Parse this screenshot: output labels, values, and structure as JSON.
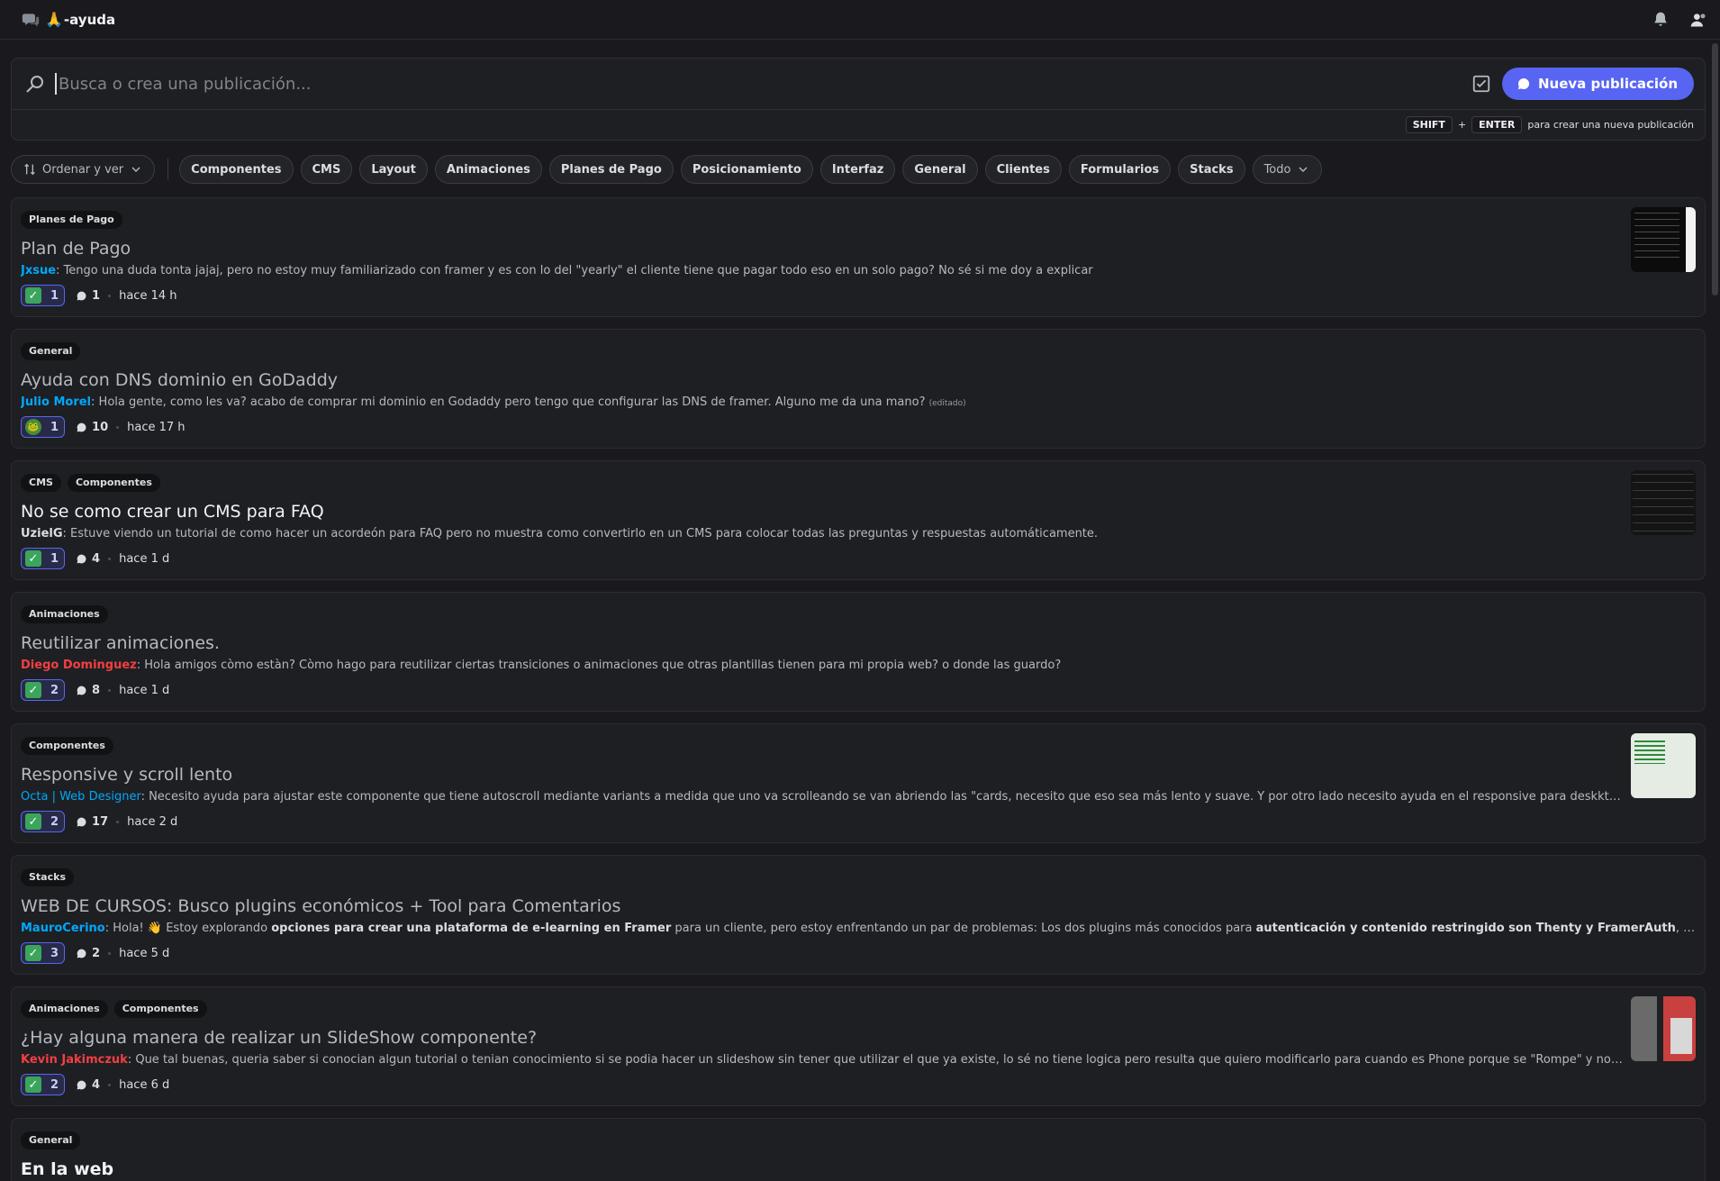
{
  "header": {
    "channel_emoji": "🙏",
    "channel_name": "-ayuda",
    "icons": [
      "forum-icon",
      "bell-icon",
      "members-icon"
    ]
  },
  "search": {
    "placeholder": "Busca o crea una publicación...",
    "new_post_label": "Nueva publicación",
    "hint_key1": "SHIFT",
    "hint_plus": "+",
    "hint_key2": "ENTER",
    "hint_text": "para crear una nueva publicación"
  },
  "filters": {
    "sort_label": "Ordenar y ver",
    "tags": [
      "Componentes",
      "CMS",
      "Layout",
      "Animaciones",
      "Planes de Pago",
      "Posicionamiento",
      "Interfaz",
      "General",
      "Clientes",
      "Formularios",
      "Stacks"
    ],
    "all_label": "Todo"
  },
  "colors": {
    "accent": "#5865f2",
    "author_blue": "#00a8fc",
    "author_red": "#f23f43",
    "background": "#1a1a1e",
    "card": "#1e1f22"
  },
  "posts": [
    {
      "tags": [
        "Planes de Pago"
      ],
      "title": "Plan de Pago",
      "author": "Jxsue",
      "author_sep": ":",
      "body": " Tengo una duda tonta jajaj, pero no estoy muy familiarizado con framer y es con lo del \"yearly\" el cliente tiene que pagar todo eso en un solo pago? No sé si me doy a explicar",
      "reaction": "✓",
      "reaction_count": "1",
      "comments": "1",
      "time": "hace 14 h"
    },
    {
      "tags": [
        "General"
      ],
      "title": "Ayuda con DNS dominio en GoDaddy",
      "author": "Julio Morel",
      "author_sep": ":",
      "body": " Hola gente, como les va? acabo de comprar mi dominio en Godaddy pero tengo que configurar las DNS de framer. Alguno me da una mano? ",
      "edited": "(editado)",
      "reaction": "🐸",
      "reaction_count": "1",
      "comments": "10",
      "time": "hace 17 h"
    },
    {
      "tags": [
        "CMS",
        "Componentes"
      ],
      "title": "No se como crear un CMS para FAQ",
      "author": "UzielG",
      "author_sep": ":",
      "body": " Estuve viendo un tutorial de como hacer un acordeón para FAQ pero no muestra como convertirlo en un CMS para colocar todas las preguntas y respuestas automáticamente.",
      "reaction": "✓",
      "reaction_count": "1",
      "comments": "4",
      "time": "hace 1 d"
    },
    {
      "tags": [
        "Animaciones"
      ],
      "title": "Reutilizar animaciones.",
      "author": "Diego Dominguez",
      "author_sep": ":",
      "body": " Hola amigos còmo estàn? Còmo hago para reutilizar ciertas transiciones o animaciones que otras plantillas tienen para mi propia web? o donde las guardo?",
      "reaction": "✓",
      "reaction_count": "2",
      "comments": "8",
      "time": "hace 1 d"
    },
    {
      "tags": [
        "Componentes"
      ],
      "title": "Responsive y scroll lento",
      "author": "Octa | Web Designer",
      "author_sep": ":",
      "body": " Necesito ayuda para ajustar este componente que tiene autoscroll mediante variants a medida que uno va scrolleando se van abriendo las \"cards, necesito que eso sea más lento y suave. Y por otro lado necesito ayuda en el responsive para deskktop y mobile. En pc no se ab...",
      "reaction": "✓",
      "reaction_count": "2",
      "comments": "17",
      "time": "hace 2 d"
    },
    {
      "tags": [
        "Stacks"
      ],
      "title": "WEB DE CURSOS: Busco plugins económicos + Tool para Comentarios",
      "author": "MauroCerino",
      "author_sep": ":",
      "body_parts": [
        " Hola! 👋 Estoy explorando ",
        "opciones para crear una plataforma de e-learning en Framer",
        " para un cliente, pero estoy enfrentando un par de problemas: Los dos plugins más conocidos para ",
        "autenticación y contenido restringido son Thenty y FramerAuth",
        ", pero ambos funcionan con modelo de s..."
      ],
      "reaction": "✓",
      "reaction_count": "3",
      "comments": "2",
      "time": "hace 5 d"
    },
    {
      "tags": [
        "Animaciones",
        "Componentes"
      ],
      "title": "¿Hay alguna manera de realizar un SlideShow componente?",
      "author": "Kevin Jakimczuk",
      "author_sep": ":",
      "body": " Que tal buenas, queria saber si conocian algun tutorial o tenian conocimiento si se podia hacer un slideshow sin tener que utilizar el que ya existe, lo sé no tiene logica pero resulta que quiero modificarlo para cuando es Phone porque se \"Rompe\" y no puedo y cuando intento rea...",
      "reaction": "✓",
      "reaction_count": "2",
      "comments": "4",
      "time": "hace 6 d"
    },
    {
      "tags": [
        "General"
      ],
      "title": "En la web"
    }
  ]
}
